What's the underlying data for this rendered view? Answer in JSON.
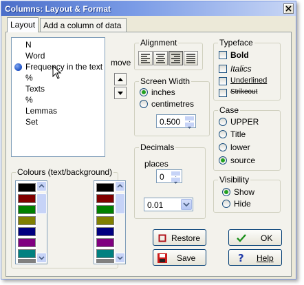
{
  "window": {
    "title": "Columns: Layout & Format"
  },
  "tabs": [
    {
      "label": "Layout"
    },
    {
      "label": "Add a column of data"
    }
  ],
  "columns_list": {
    "items": [
      {
        "label": "N"
      },
      {
        "label": "Word"
      },
      {
        "label": "Frequency in the text",
        "marked": true
      },
      {
        "label": "%"
      },
      {
        "label": "Texts"
      },
      {
        "label": "%"
      },
      {
        "label": "Lemmas"
      },
      {
        "label": "Set"
      }
    ]
  },
  "move": {
    "label": "move"
  },
  "alignment": {
    "label": "Alignment",
    "options": [
      "left",
      "center",
      "right",
      "justify"
    ],
    "selected": "right"
  },
  "screen_width": {
    "label": "Screen Width",
    "options": [
      {
        "label": "inches",
        "checked": true
      },
      {
        "label": "centimetres",
        "checked": false
      }
    ],
    "value": "0.500"
  },
  "decimals": {
    "label": "Decimals",
    "places_label": "places",
    "places_value": "0",
    "rounding_value": "0.01"
  },
  "typeface": {
    "label": "Typeface",
    "options": [
      {
        "label": "Bold",
        "checked": false
      },
      {
        "label": "Italics",
        "checked": false
      },
      {
        "label": "Underlined",
        "checked": false
      },
      {
        "label": "Strikeout",
        "checked": false
      }
    ]
  },
  "case": {
    "label": "Case",
    "options": [
      {
        "label": "UPPER",
        "checked": false
      },
      {
        "label": "Title",
        "checked": false
      },
      {
        "label": "lower",
        "checked": false
      },
      {
        "label": "source",
        "checked": true
      }
    ]
  },
  "visibility": {
    "label": "Visibility",
    "options": [
      {
        "label": "Show",
        "checked": true
      },
      {
        "label": "Hide",
        "checked": false
      }
    ]
  },
  "colours": {
    "label": "Colours (text/background)",
    "swatches": [
      "#000000",
      "#800000",
      "#008000",
      "#808000",
      "#000080",
      "#800080",
      "#008080",
      "#808080"
    ]
  },
  "buttons": {
    "restore": "Restore",
    "save": "Save",
    "ok": "OK",
    "help": "Help"
  }
}
